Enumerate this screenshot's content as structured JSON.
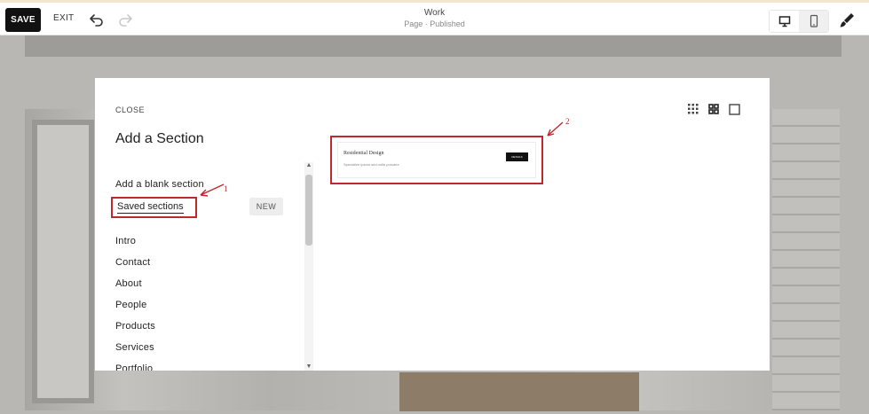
{
  "toolbar": {
    "save_label": "SAVE",
    "exit_label": "EXIT",
    "page_title": "Work",
    "page_status": "Page · Published",
    "icons": [
      "undo-icon",
      "redo-icon",
      "desktop-icon",
      "mobile-icon",
      "style-brush-icon"
    ]
  },
  "modal": {
    "close_label": "CLOSE",
    "title": "Add a Section",
    "blank_section_label": "Add a blank section",
    "saved_sections_label": "Saved sections",
    "new_badge": "NEW",
    "categories": [
      "Intro",
      "Contact",
      "About",
      "People",
      "Products",
      "Services",
      "Portfolio"
    ],
    "view_icons": [
      "grid-small-icon",
      "grid-large-icon",
      "single-view-icon"
    ],
    "preview": {
      "heading": "Residential Design",
      "subtext": "Specialize ipsum sed nulla posuere",
      "button": "DETAILS"
    }
  },
  "annotations": {
    "marker_1": "1",
    "marker_2": "2"
  },
  "colors": {
    "annotation_red": "#c0282e",
    "save_bg": "#111111",
    "overlay_bg": "#b9b7b3"
  }
}
